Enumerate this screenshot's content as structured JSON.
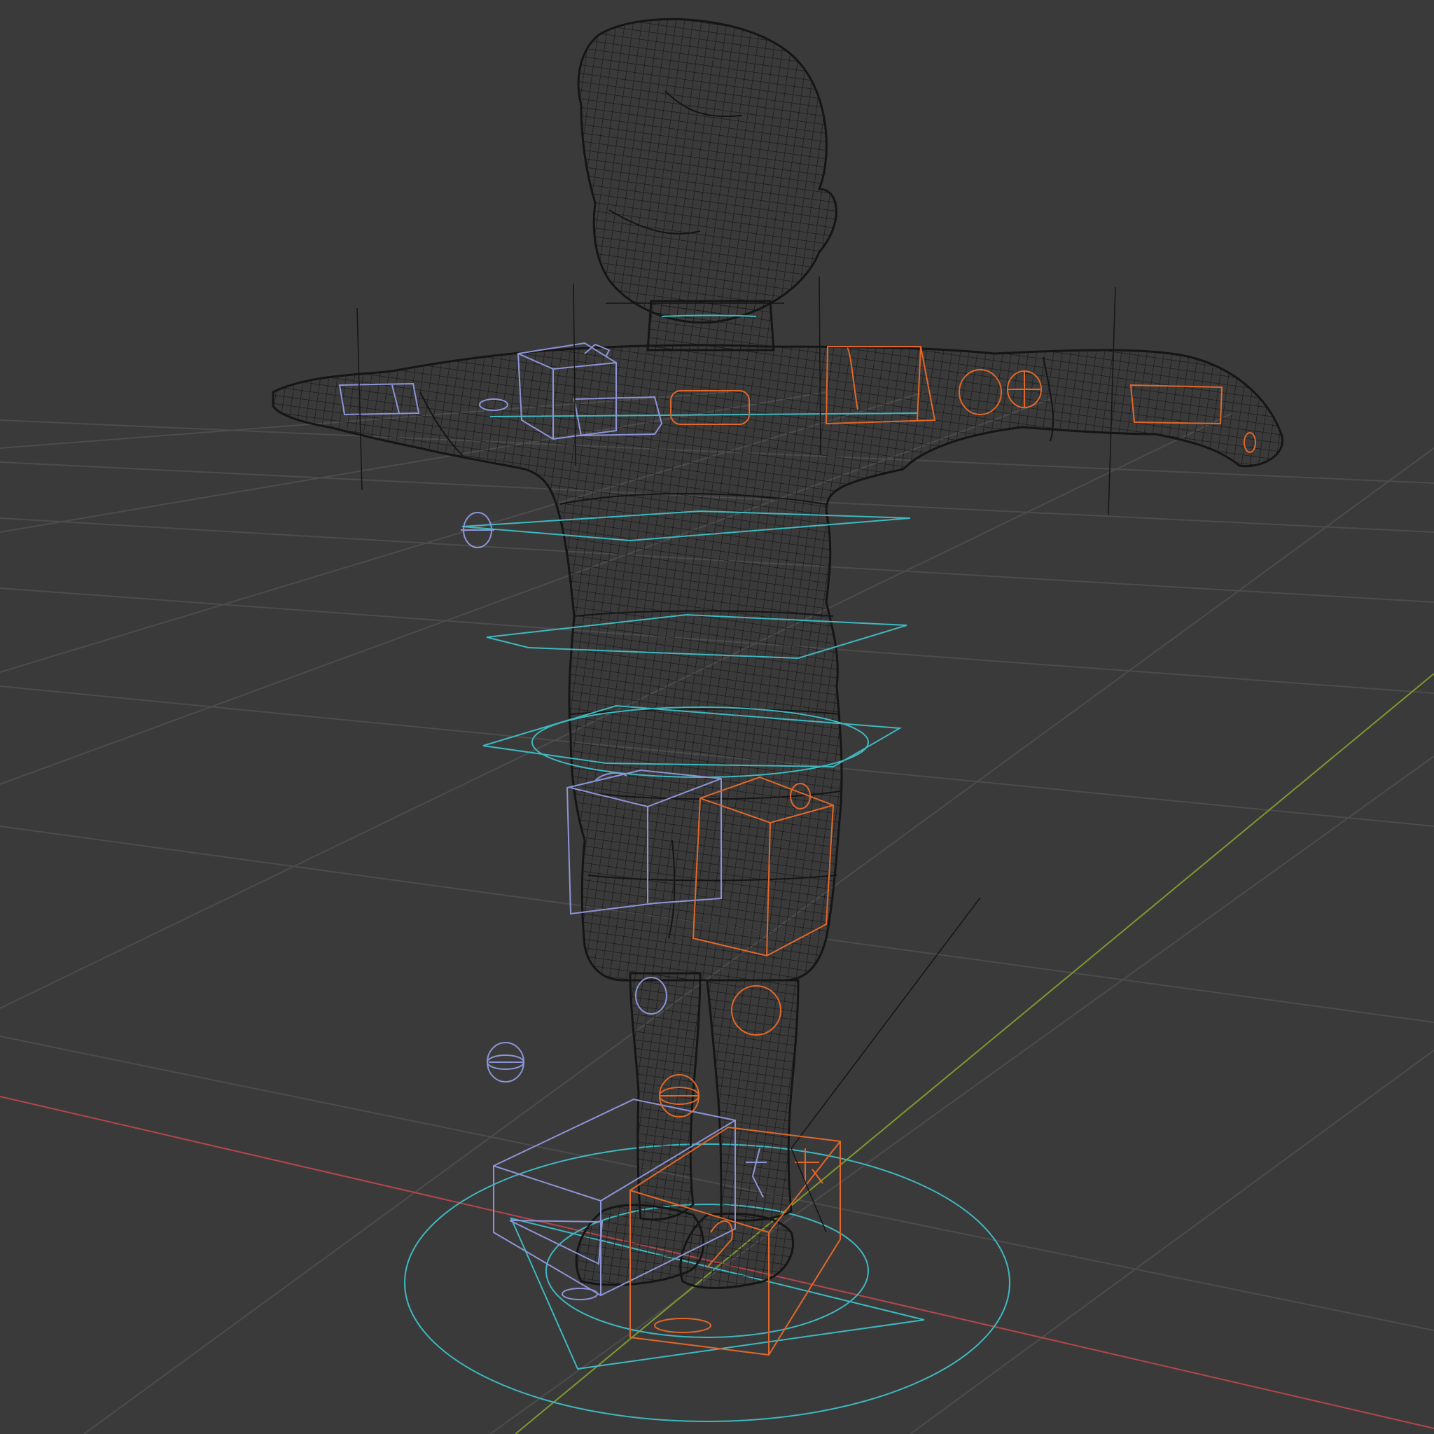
{
  "viewport": {
    "mode": "wireframe",
    "background": "#3a3a3a",
    "grid_color": "#4c4c4c",
    "axis_x_color": "#b4464b",
    "axis_y_color": "#7e9a2e",
    "mesh_color": "#151515",
    "left_controls_color": "#8d95d8",
    "right_controls_color": "#e0682a",
    "center_controls_color": "#3fb8c0"
  }
}
